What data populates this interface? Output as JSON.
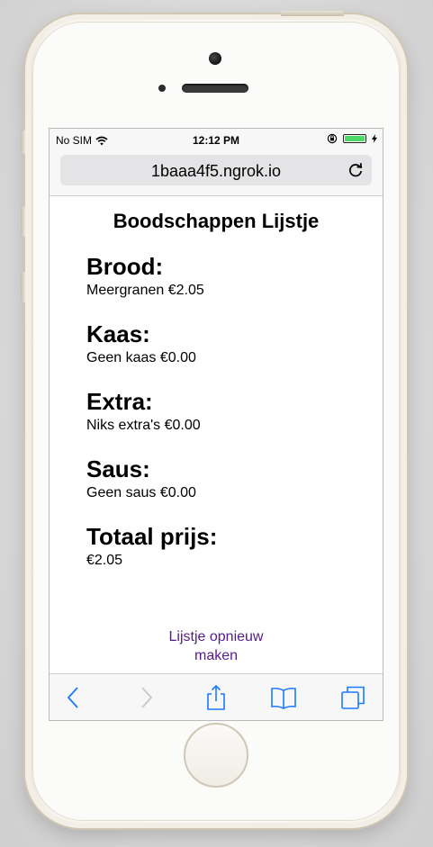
{
  "status_bar": {
    "carrier": "No SIM",
    "time": "12:12 PM"
  },
  "browser": {
    "url": "1baaa4f5.ngrok.io"
  },
  "page": {
    "title": "Boodschappen Lijstje",
    "sections": [
      {
        "heading": "Brood:",
        "value": "Meergranen €2.05"
      },
      {
        "heading": "Kaas:",
        "value": "Geen kaas €0.00"
      },
      {
        "heading": "Extra:",
        "value": "Niks extra's €0.00"
      },
      {
        "heading": "Saus:",
        "value": "Geen saus €0.00"
      },
      {
        "heading": "Totaal prijs:",
        "value": "€2.05"
      }
    ],
    "rebuild_link": {
      "line1": "Lijstje opnieuw",
      "line2": "maken"
    }
  },
  "colors": {
    "link": "#551a8b",
    "toolbar_icon": "#1a7aff",
    "battery": "#4cd964"
  },
  "icons": [
    "wifi-icon",
    "orientation-lock-icon",
    "battery-icon",
    "charging-icon",
    "reload-icon",
    "back-icon",
    "forward-icon",
    "share-icon",
    "bookmarks-icon",
    "tabs-icon"
  ]
}
